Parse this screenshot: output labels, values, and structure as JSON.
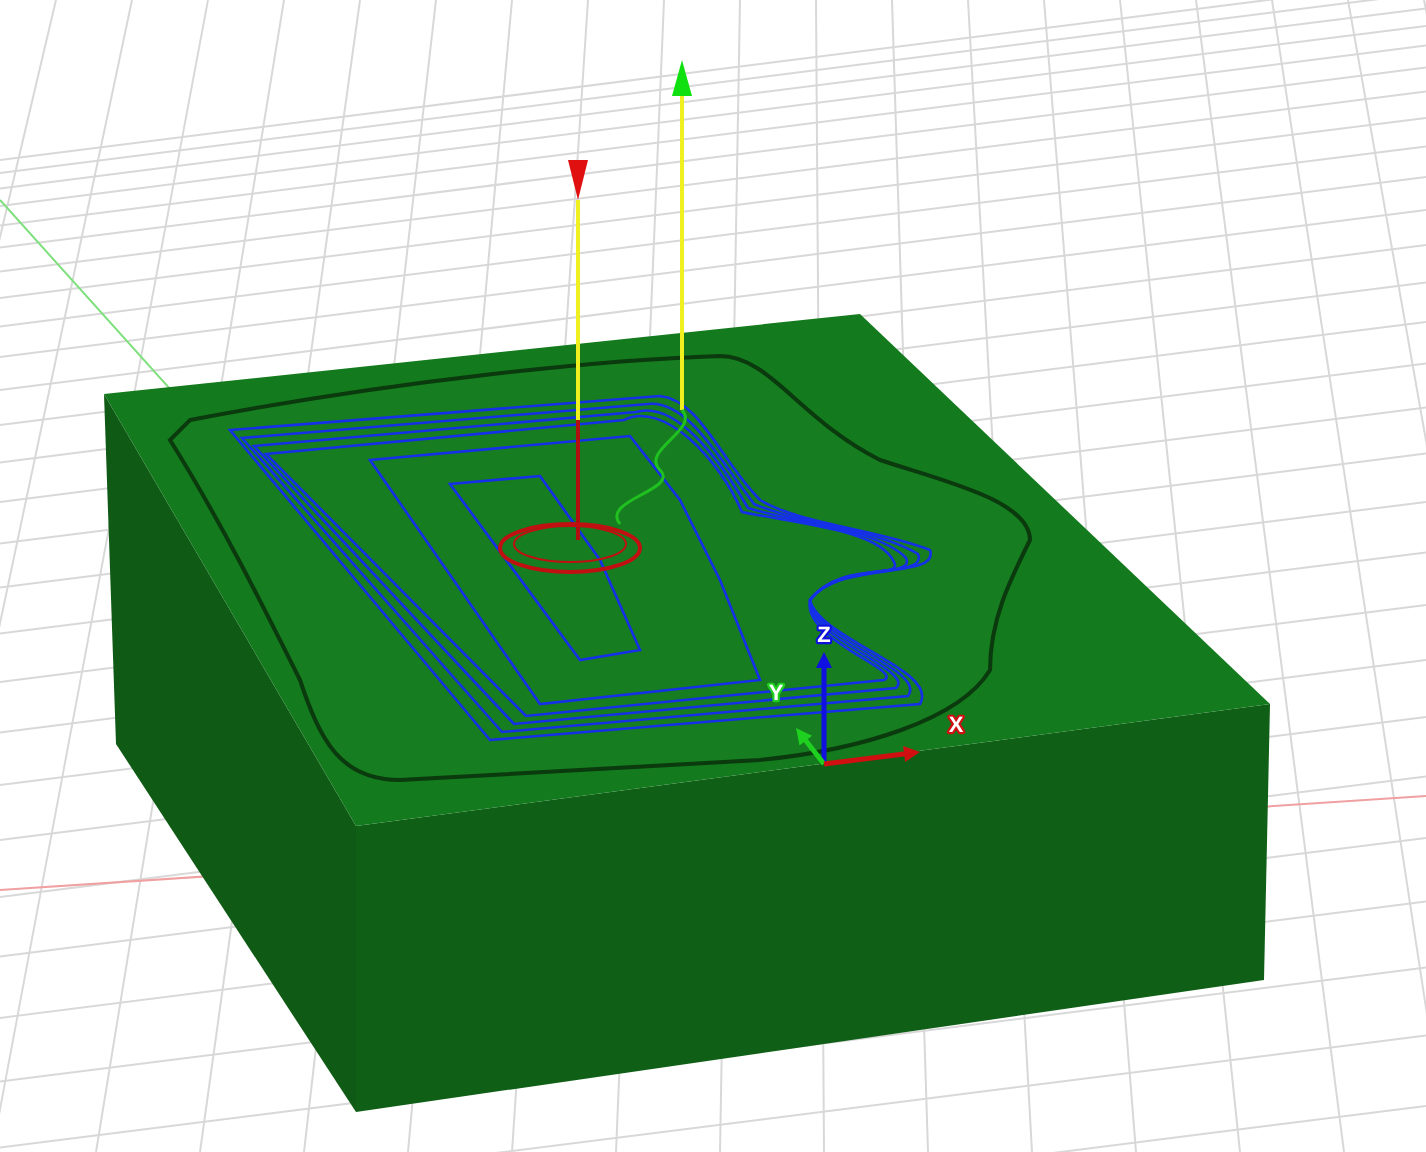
{
  "viewport": {
    "axes": [
      {
        "label": "Z",
        "color": "#1010e0"
      },
      {
        "label": "Y",
        "color": "#20d020"
      },
      {
        "label": "X",
        "color": "#d01010"
      }
    ]
  }
}
